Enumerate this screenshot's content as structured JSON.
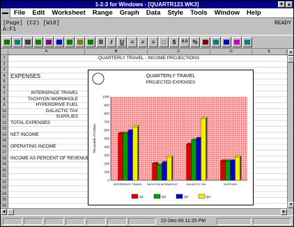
{
  "window": {
    "title": "1-2-3 for Windows - [QUARTR123.WK3]"
  },
  "menu": [
    "File",
    "Edit",
    "Worksheet",
    "Range",
    "Graph",
    "Data",
    "Style",
    "Tools",
    "Window",
    "Help"
  ],
  "info": {
    "format": "[Page] (C2) [W18]",
    "address": "A:F1",
    "mode": "READY"
  },
  "toolbar": {
    "bold": "B",
    "italic": "I",
    "underline": "U",
    "currency": "$",
    "percent": "0.0",
    "percent_sign": "%"
  },
  "sheet": {
    "columns": [
      "A",
      "B",
      "C",
      "D",
      "E"
    ],
    "rows": [
      "1",
      "2",
      "3",
      "4",
      "5",
      "6",
      "7",
      "8",
      "9",
      "10",
      "11",
      "12",
      "13",
      "14",
      "15",
      "16",
      "17",
      "18",
      "19",
      "20",
      "21",
      "22",
      "23",
      "24",
      "25",
      "26"
    ],
    "header_text": "QUARTERLY TRAVEL - INCOME PROJECTIONS",
    "expenses_label": "EXPENSES",
    "expense_items": [
      "INTERSPACE TRAVEL",
      "TACHYON WORMHOLE",
      "HYPERDRIVE FUEL",
      "GALACTIC TAX",
      "SUPPLIES"
    ],
    "total_label": "TOTAL EXPENSES",
    "net_income_label": "NET INCOME",
    "operating_income_label": "OPERATING INCOME",
    "income_pct_label": "INCOME AS PERCENT OF REVENUE"
  },
  "chart_data": {
    "type": "bar",
    "title": "QUARTERLY TRAVEL",
    "subtitle": "PROJECTED EXPENSES",
    "ylabel": "Thousands of Dollars",
    "categories": [
      "INTERSPACE TRAVEL",
      "TACHYON WORMHOLE",
      "GALACTIC TAX",
      "SUPPLIES"
    ],
    "ylim": [
      0,
      1000
    ],
    "yticks": [
      "0",
      "100",
      "200",
      "300",
      "400",
      "500",
      "600",
      "700",
      "800",
      "900",
      "1000"
    ],
    "series": [
      {
        "name": "Q1",
        "color": "#e00000",
        "values": [
          560,
          200,
          430,
          230
        ]
      },
      {
        "name": "Q2",
        "color": "#00a000",
        "values": [
          560,
          180,
          480,
          230
        ]
      },
      {
        "name": "Q3",
        "color": "#0000d0",
        "values": [
          590,
          210,
          500,
          230
        ]
      },
      {
        "name": "Q4",
        "color": "#f0f000",
        "values": [
          640,
          280,
          740,
          280
        ]
      }
    ],
    "legend_placement": "bottom"
  },
  "status": {
    "datetime": "22-Dec-93 11:25 PM"
  }
}
